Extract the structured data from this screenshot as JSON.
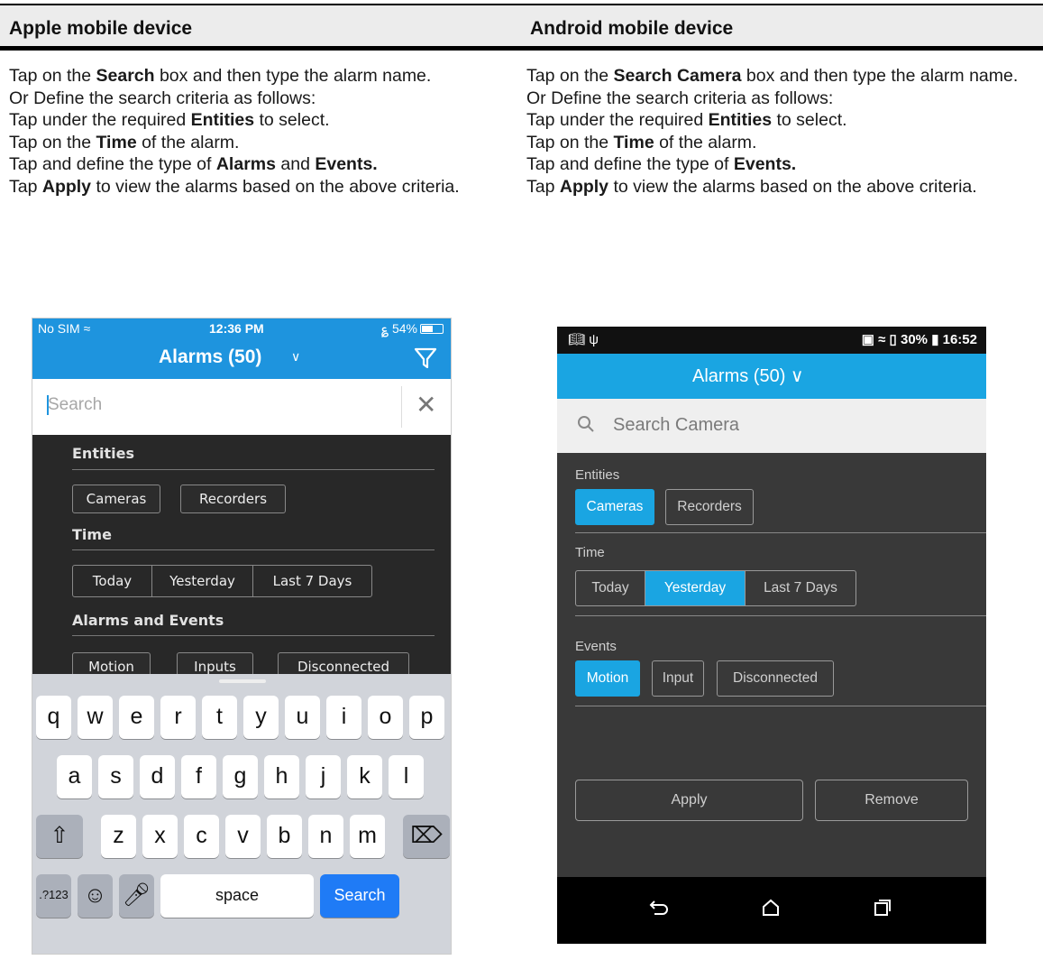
{
  "header": {
    "col1": "Apple mobile device",
    "col2": "Android mobile device"
  },
  "apple_instructions": {
    "l1a": "Tap on the ",
    "l1b": "Search",
    "l1c": " box and then type the alarm name.",
    "l2": "Or Define the search criteria as follows:",
    "l3a": "Tap under the required ",
    "l3b": "Entities",
    "l3c": " to select.",
    "l4a": "Tap on the ",
    "l4b": "Time",
    "l4c": " of the alarm.",
    "l5a": "Tap and define the type of ",
    "l5b": "Alarms",
    "l5c": " and ",
    "l5d": "Events.",
    "l6a": "Tap ",
    "l6b": "Apply",
    "l6c": " to view the alarms based on the above criteria."
  },
  "android_instructions": {
    "l1a": "Tap on the ",
    "l1b": "Search Camera",
    "l1c": " box and then type the alarm name.",
    "l2": "Or Define the search criteria as follows:",
    "l3a": "Tap under the required ",
    "l3b": "Entities",
    "l3c": " to select.",
    "l4a": "Tap on the ",
    "l4b": "Time",
    "l4c": " of the alarm.",
    "l5a": "Tap and define the type of ",
    "l5b": "Events.",
    "l6a": "Tap ",
    "l6b": "Apply",
    "l6c": " to view the alarms based on the above criteria."
  },
  "ios": {
    "status": {
      "carrier": "No SIM",
      "time": "12:36 PM",
      "battery": "54%"
    },
    "nav_title": "Alarms (50)",
    "search_placeholder": "Search",
    "entities_label": "Entities",
    "entities": [
      "Cameras",
      "Recorders"
    ],
    "time_label": "Time",
    "time_options": [
      "Today",
      "Yesterday",
      "Last 7 Days"
    ],
    "alarms_label": "Alarms and Events",
    "alarm_options": [
      "Motion",
      "Inputs",
      "Disconnected"
    ],
    "keyboard": {
      "row1": [
        "q",
        "w",
        "e",
        "r",
        "t",
        "y",
        "u",
        "i",
        "o",
        "p"
      ],
      "row2": [
        "a",
        "s",
        "d",
        "f",
        "g",
        "h",
        "j",
        "k",
        "l"
      ],
      "row3": [
        "z",
        "x",
        "c",
        "v",
        "b",
        "n",
        "m"
      ],
      "numbers": ".?123",
      "space": "space",
      "search": "Search"
    }
  },
  "android": {
    "status": {
      "battery": "30%",
      "time": "16:52"
    },
    "nav_title": "Alarms (50)",
    "search_placeholder": "Search Camera",
    "entities_label": "Entities",
    "entities": [
      "Cameras",
      "Recorders"
    ],
    "time_label": "Time",
    "time_options": [
      "Today",
      "Yesterday",
      "Last 7 Days"
    ],
    "events_label": "Events",
    "event_options": [
      "Motion",
      "Input",
      "Disconnected"
    ],
    "apply": "Apply",
    "remove": "Remove"
  },
  "colors": {
    "ios_blue": "#1e94de",
    "android_blue": "#1aa5e2",
    "ios_search_key": "#1f7bf6"
  }
}
